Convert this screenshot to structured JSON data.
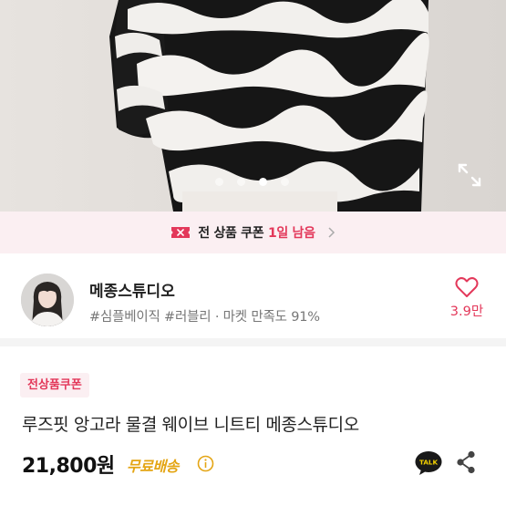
{
  "gallery": {
    "image_alt": "black and white wave pattern knit sweater",
    "slide_count": 4,
    "active_slide": 3
  },
  "coupon_banner": {
    "label": "전 상품 쿠폰",
    "remaining": "1일 남음"
  },
  "shop": {
    "name": "메종스튜디오",
    "tags": "#심플베이직 #러블리",
    "rating_sep": " · ",
    "rating": "마켓 만족도 91%",
    "likes": "3.9만"
  },
  "product": {
    "badge": "전상품쿠폰",
    "title": "루즈핏 앙고라 물결 웨이브 니트티 메종스튜디오",
    "price": "21,800원",
    "shipping": "무료배송"
  },
  "actions": {
    "talk_label": "TALK"
  },
  "colors": {
    "accent": "#e3385a",
    "shipping": "#e4a514",
    "banner_bg": "#fbeff2",
    "talk": "#191919"
  }
}
